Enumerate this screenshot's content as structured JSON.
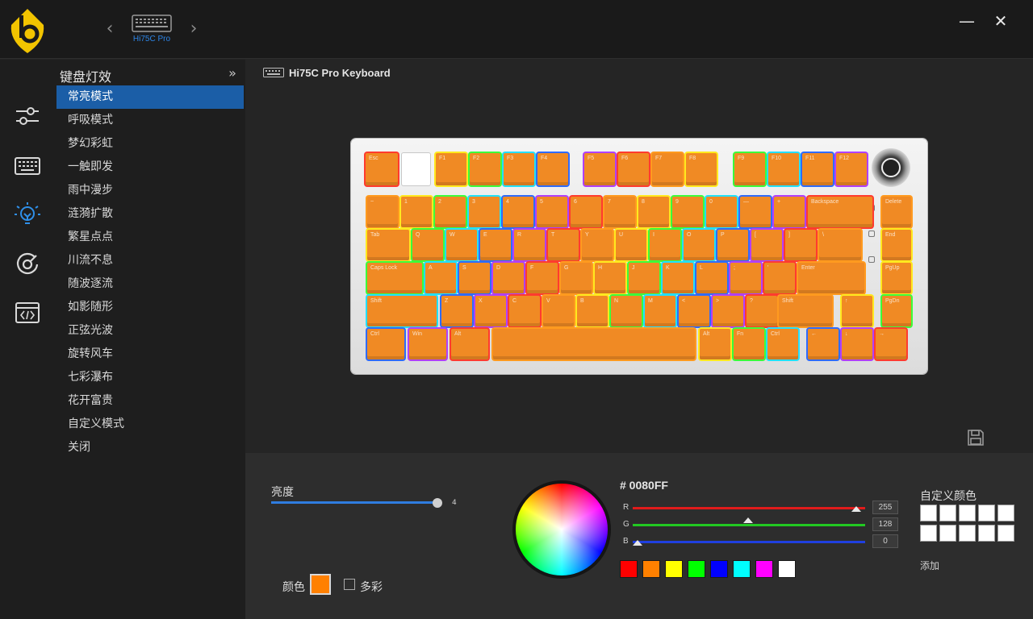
{
  "topbar": {
    "device_name": "Hi75C Pro",
    "icons": {
      "logo": "brand-logo",
      "prev": "chevron-left-icon",
      "next": "chevron-right-icon",
      "minimize": "minimize-icon",
      "close": "close-icon"
    },
    "prev_glyph": "‹",
    "next_glyph": "›",
    "minimize_glyph": "—",
    "close_glyph": "✕"
  },
  "rail": {
    "items": [
      {
        "icon": "sliders-icon"
      },
      {
        "icon": "keyboard-icon"
      },
      {
        "icon": "lighting-icon",
        "active": true
      },
      {
        "icon": "disc-icon"
      },
      {
        "icon": "code-icon"
      }
    ]
  },
  "effects": {
    "title": "键盘灯效",
    "collapse_glyph": "»",
    "items": [
      "常亮模式",
      "呼吸模式",
      "梦幻彩虹",
      "一触即发",
      "雨中漫步",
      "涟漪扩散",
      "繁星点点",
      "川流不息",
      "随波逐流",
      "如影随形",
      "正弦光波",
      "旋转风车",
      "七彩瀑布",
      "花开富贵",
      "自定义模式",
      "关闭"
    ],
    "active_index": 0
  },
  "main": {
    "device_title": "Hi75C Pro Keyboard"
  },
  "keyboard": {
    "key_color": "#f08a24",
    "rows": [
      [
        "Esc",
        "",
        "F1",
        "F2",
        "F3",
        "F4",
        "F5",
        "F6",
        "F7",
        "F8",
        "F9",
        "F10",
        "F11",
        "F12"
      ],
      [
        "~",
        "1",
        "2",
        "3",
        "4",
        "5",
        "6",
        "7",
        "8",
        "9",
        "0",
        "—",
        "+",
        "Backspace",
        "Delete"
      ],
      [
        "Tab",
        "Q",
        "W",
        "E",
        "R",
        "T",
        "Y",
        "U",
        "I",
        "O",
        "P",
        "[",
        "]",
        "\\",
        "End"
      ],
      [
        "Caps Lock",
        "A",
        "S",
        "D",
        "F",
        "G",
        "H",
        "J",
        "K",
        "L",
        ";",
        "'",
        "Enter",
        "PgUp"
      ],
      [
        "Shift",
        "Z",
        "X",
        "C",
        "V",
        "B",
        "N",
        "M",
        "<",
        ">",
        "?",
        "Shift",
        "↑",
        "PgDn"
      ],
      [
        "Ctrl",
        "Win",
        "Alt",
        "",
        "Alt",
        "Fn",
        "Ctrl",
        "←",
        "↓",
        "→"
      ]
    ]
  },
  "bottom": {
    "brightness_label": "亮度",
    "brightness_value": "4",
    "brightness_max": 4,
    "color_label": "颜色",
    "current_color": "#ff8000",
    "multicolor_label": "多彩",
    "multicolor_checked": false,
    "hex": "# 0080FF",
    "rgb": [
      {
        "letter": "R",
        "value": "255",
        "color": "#e01b1b"
      },
      {
        "letter": "G",
        "value": "128",
        "color": "#22c922"
      },
      {
        "letter": "B",
        "value": "0",
        "color": "#1f3fe0"
      }
    ],
    "presets": [
      "#ff0000",
      "#ff8000",
      "#ffff00",
      "#00ff00",
      "#0000ff",
      "#00ffff",
      "#ff00ff",
      "#ffffff"
    ],
    "custom_title": "自定义颜色",
    "custom_colors": [
      "#ffffff",
      "#ffffff",
      "#ffffff",
      "#ffffff",
      "#ffffff",
      "#ffffff",
      "#ffffff",
      "#ffffff",
      "#ffffff",
      "#ffffff"
    ],
    "add_label": "添加"
  }
}
